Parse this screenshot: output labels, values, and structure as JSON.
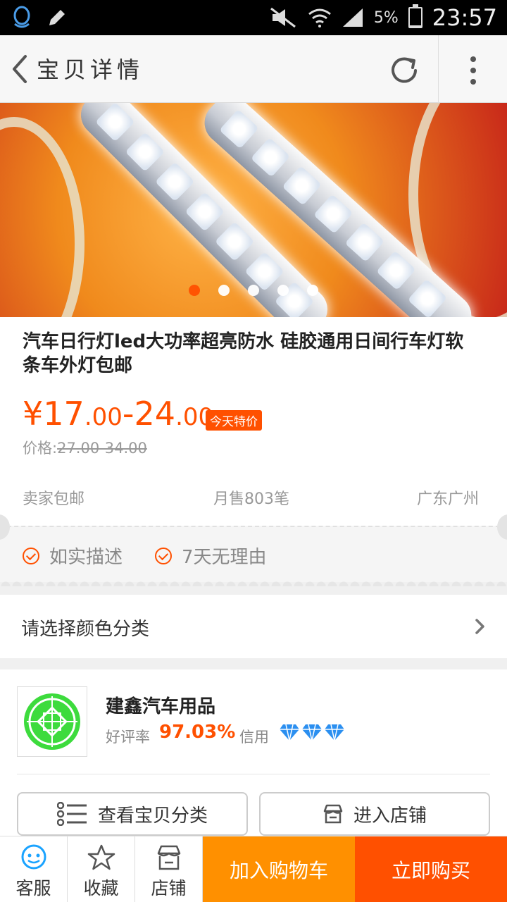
{
  "status_bar": {
    "battery": "5%",
    "battery_level": 0.05,
    "time": "23:57"
  },
  "header": {
    "title": "宝贝详情"
  },
  "carousel": {
    "slide_count": 5,
    "active_index": 0
  },
  "product": {
    "title": "汽车日行灯led大功率超亮防水 硅胶通用日间行车灯软条车外灯包邮",
    "price_symbol": "¥",
    "price_low_int": "17",
    "price_low_dec": ".00",
    "price_sep": "-",
    "price_high_int": "24",
    "price_high_dec": ".00",
    "promo_badge": "今天特价",
    "original_price_label": "价格:",
    "original_price": "27.00-34.00",
    "shipping": "卖家包邮",
    "monthly_sales": "月售803笔",
    "location": "广东广州"
  },
  "guarantees": [
    "如实描述",
    "7天无理由"
  ],
  "sku_selector": {
    "label": "请选择颜色分类"
  },
  "shop": {
    "name": "建鑫汽车用品",
    "rating_label": "好评率",
    "rating": "97.03%",
    "credit_label": "信用",
    "credit_diamonds": 3,
    "view_categories_label": "查看宝贝分类",
    "enter_shop_label": "进入店铺"
  },
  "bottom_bar": {
    "service_label": "客服",
    "favorite_label": "收藏",
    "store_label": "店铺",
    "add_to_cart_label": "加入购物车",
    "buy_now_label": "立即购买"
  },
  "colors": {
    "accent": "#ff5000",
    "cart": "#ff9000",
    "service_icon": "#1aa3ff",
    "diamond": "#2b8ff0"
  }
}
